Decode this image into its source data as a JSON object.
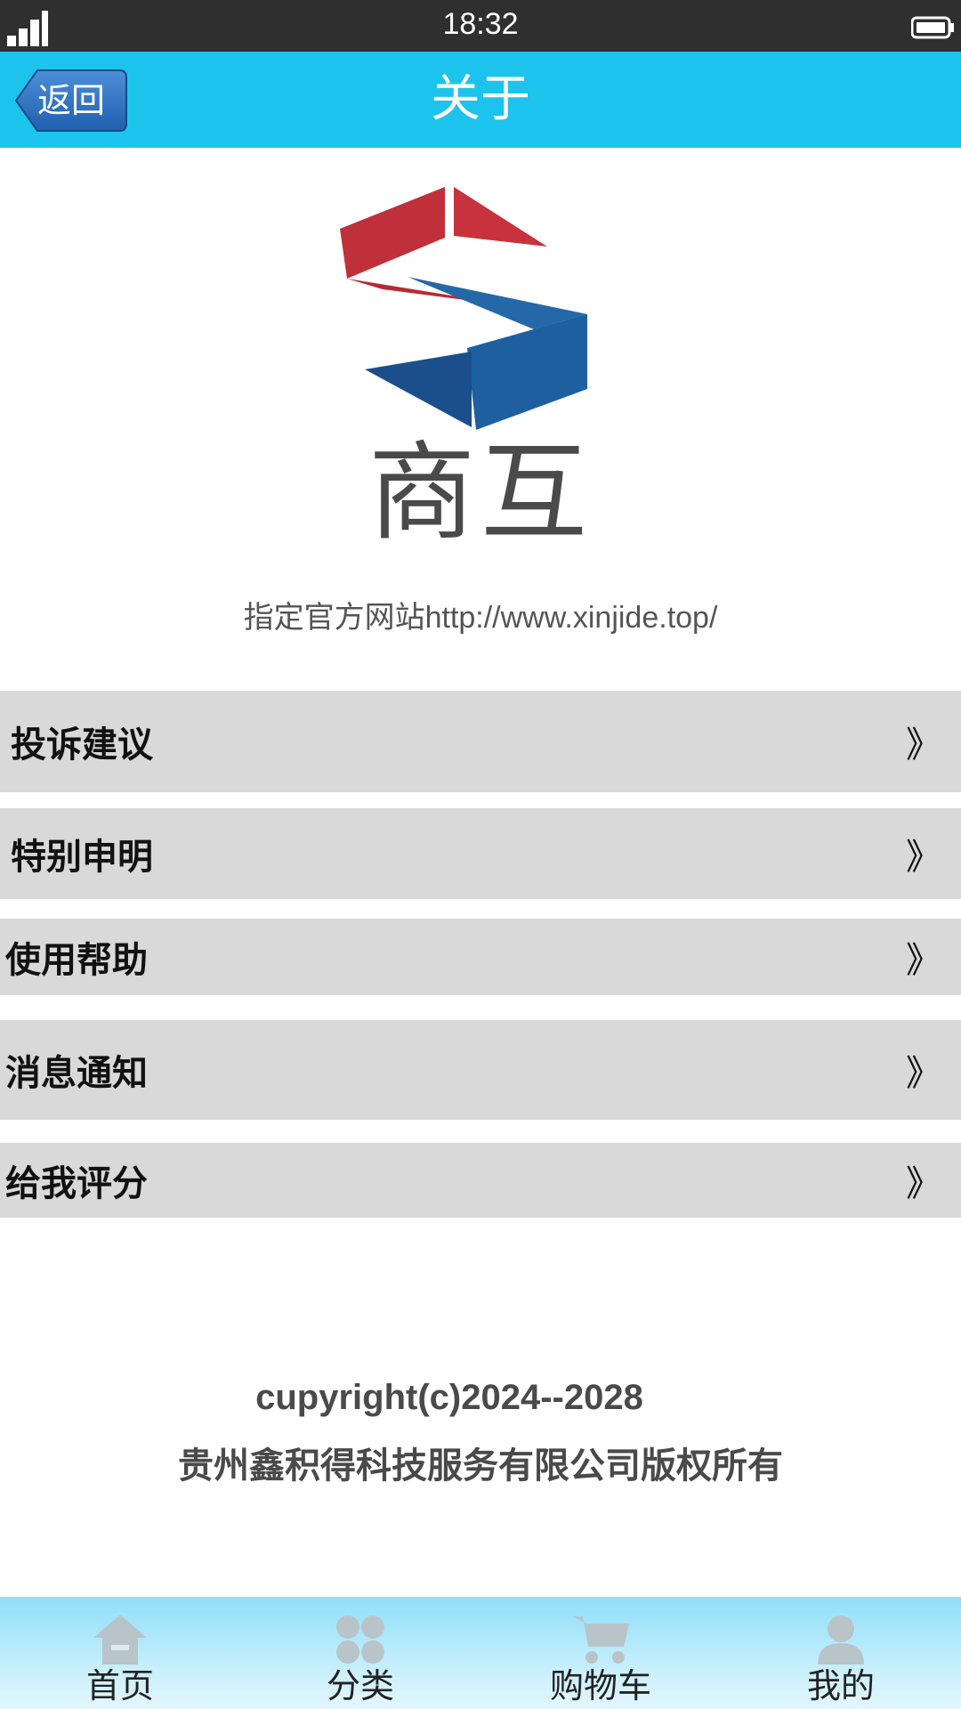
{
  "status_bar": {
    "time": "18:32",
    "icons": [
      "signal-icon",
      "battery-icon"
    ]
  },
  "nav": {
    "back_label": "返回",
    "title": "关于",
    "accent_color": "#1cc3ec"
  },
  "logo": {
    "text": "商互",
    "colors": {
      "red": "#c8323c",
      "blue": "#1e5fa0"
    }
  },
  "website": "指定官方网站http://www.xinjide.top/",
  "menu": {
    "items": [
      {
        "label": "投诉建议",
        "arrow": "》"
      },
      {
        "label": "特别申明",
        "arrow": "》"
      },
      {
        "label": "使用帮助",
        "arrow": "》"
      },
      {
        "label": "消息通知",
        "arrow": "》"
      },
      {
        "label": "给我评分",
        "arrow": "》"
      }
    ]
  },
  "copyright": {
    "line1": "cupyright(c)2024--2028",
    "line2": "贵州鑫积得科技服务有限公司版权所有"
  },
  "tabbar": {
    "items": [
      {
        "label": "首页",
        "icon": "home-icon"
      },
      {
        "label": "分类",
        "icon": "category-icon"
      },
      {
        "label": "购物车",
        "icon": "cart-icon"
      },
      {
        "label": "我的",
        "icon": "user-icon"
      }
    ]
  }
}
